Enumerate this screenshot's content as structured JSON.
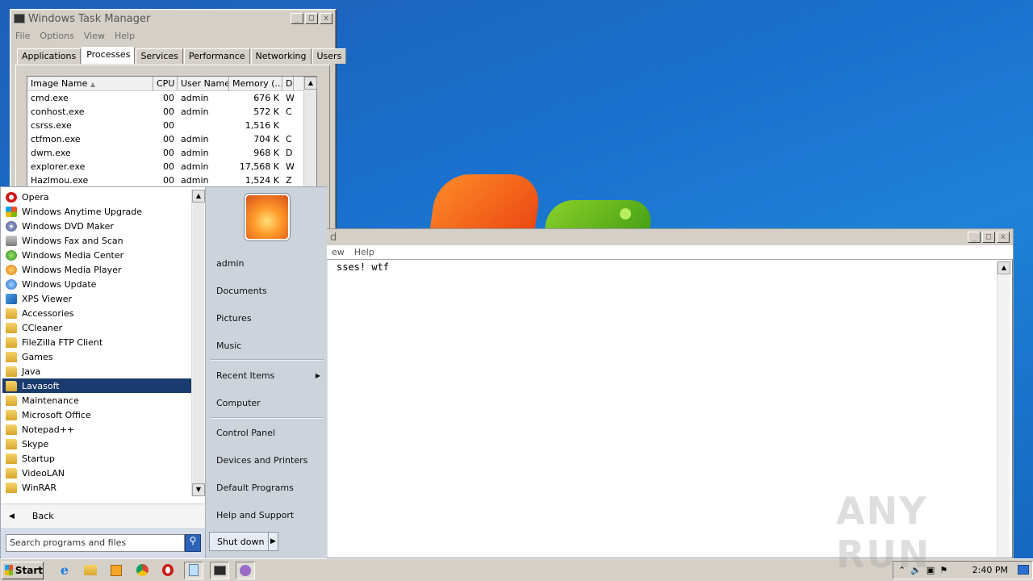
{
  "taskmanager": {
    "title": "Windows Task Manager",
    "menu": [
      "File",
      "Options",
      "View",
      "Help"
    ],
    "tabs": [
      "Applications",
      "Processes",
      "Services",
      "Performance",
      "Networking",
      "Users"
    ],
    "columns": [
      "Image Name",
      "CPU",
      "User Name",
      "Memory (...",
      "D"
    ],
    "rows": [
      {
        "name": "cmd.exe",
        "cpu": "00",
        "user": "admin",
        "mem": "676 K",
        "d": "W"
      },
      {
        "name": "conhost.exe",
        "cpu": "00",
        "user": "admin",
        "mem": "572 K",
        "d": "C"
      },
      {
        "name": "csrss.exe",
        "cpu": "00",
        "user": "",
        "mem": "1,516 K",
        "d": ""
      },
      {
        "name": "ctfmon.exe",
        "cpu": "00",
        "user": "admin",
        "mem": "704 K",
        "d": "C"
      },
      {
        "name": "dwm.exe",
        "cpu": "00",
        "user": "admin",
        "mem": "968 K",
        "d": "D"
      },
      {
        "name": "explorer.exe",
        "cpu": "00",
        "user": "admin",
        "mem": "17,568 K",
        "d": "W"
      },
      {
        "name": "Hazlmou.exe",
        "cpu": "00",
        "user": "admin",
        "mem": "1,524 K",
        "d": "Z"
      }
    ]
  },
  "notepad": {
    "title": "d",
    "menu": [
      "ew",
      "Help"
    ],
    "text": "sses! wtf"
  },
  "startmenu": {
    "programs": [
      {
        "label": "Opera",
        "icon": "opera-icon"
      },
      {
        "label": "Windows Anytime Upgrade",
        "icon": "upgrade-icon"
      },
      {
        "label": "Windows DVD Maker",
        "icon": "dvd-icon"
      },
      {
        "label": "Windows Fax and Scan",
        "icon": "fax-icon"
      },
      {
        "label": "Windows Media Center",
        "icon": "media-center-icon"
      },
      {
        "label": "Windows Media Player",
        "icon": "media-player-icon"
      },
      {
        "label": "Windows Update",
        "icon": "update-icon"
      },
      {
        "label": "XPS Viewer",
        "icon": "xps-icon"
      },
      {
        "label": "Accessories",
        "icon": "folder-icon"
      },
      {
        "label": "CCleaner",
        "icon": "folder-icon"
      },
      {
        "label": "FileZilla FTP Client",
        "icon": "folder-icon"
      },
      {
        "label": "Games",
        "icon": "folder-icon"
      },
      {
        "label": "Java",
        "icon": "folder-icon"
      },
      {
        "label": "Lavasoft",
        "icon": "folder-icon"
      },
      {
        "label": "Maintenance",
        "icon": "folder-icon"
      },
      {
        "label": "Microsoft Office",
        "icon": "folder-icon"
      },
      {
        "label": "Notepad++",
        "icon": "folder-icon"
      },
      {
        "label": "Skype",
        "icon": "folder-icon"
      },
      {
        "label": "Startup",
        "icon": "folder-icon"
      },
      {
        "label": "VideoLAN",
        "icon": "folder-icon"
      },
      {
        "label": "WinRAR",
        "icon": "folder-icon"
      }
    ],
    "selected": "Lavasoft",
    "back_label": "Back",
    "search_placeholder": "Search programs and files",
    "right_items": {
      "user": "admin",
      "documents": "Documents",
      "pictures": "Pictures",
      "music": "Music",
      "recent": "Recent Items",
      "computer": "Computer",
      "control_panel": "Control Panel",
      "devices": "Devices and Printers",
      "default_programs": "Default Programs",
      "help": "Help and Support"
    },
    "shutdown_label": "Shut down"
  },
  "taskbar": {
    "start_label": "Start",
    "clock": "2:40 PM",
    "apps": [
      "ie-icon",
      "explorer-icon",
      "media-player-icon",
      "chrome-icon",
      "opera-icon",
      "notepad-icon",
      "taskmanager-icon",
      "app-icon"
    ]
  },
  "watermark": "ANY RUN"
}
